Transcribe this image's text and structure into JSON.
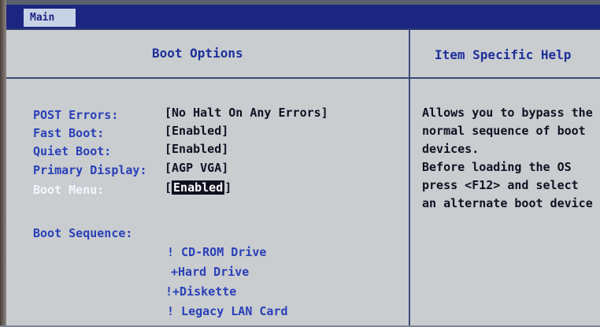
{
  "menubar": {
    "tab": "Main"
  },
  "left_panel": {
    "title": "Boot Options"
  },
  "right_panel": {
    "title": "Item Specific Help"
  },
  "settings": [
    {
      "label": "POST Errors:",
      "value": "[No Halt On Any Errors]"
    },
    {
      "label": "Fast Boot:",
      "value": "[Enabled]"
    },
    {
      "label": "Quiet Boot:",
      "value": "[Enabled]"
    },
    {
      "label": "Primary Display:",
      "value": "[AGP VGA]"
    },
    {
      "label": "Boot Menu:",
      "value_open": "[",
      "value_selected": "Enabled",
      "value_close": "]"
    }
  ],
  "boot_sequence": {
    "label": "Boot Sequence:",
    "items": [
      "! CD-ROM Drive",
      "+Hard Drive",
      "!+Diskette",
      "! Legacy LAN Card"
    ]
  },
  "help_lines": [
    "Allows you to bypass the",
    "normal sequence of boot",
    "devices.",
    "Before loading the OS",
    "press <F12> and select",
    "an alternate boot device"
  ],
  "colors": {
    "menubar": "#1c2680",
    "background": "#c9cdd0",
    "label": "#2a40b8",
    "highlight_label": "#f4f6ff",
    "value": "#101020"
  }
}
